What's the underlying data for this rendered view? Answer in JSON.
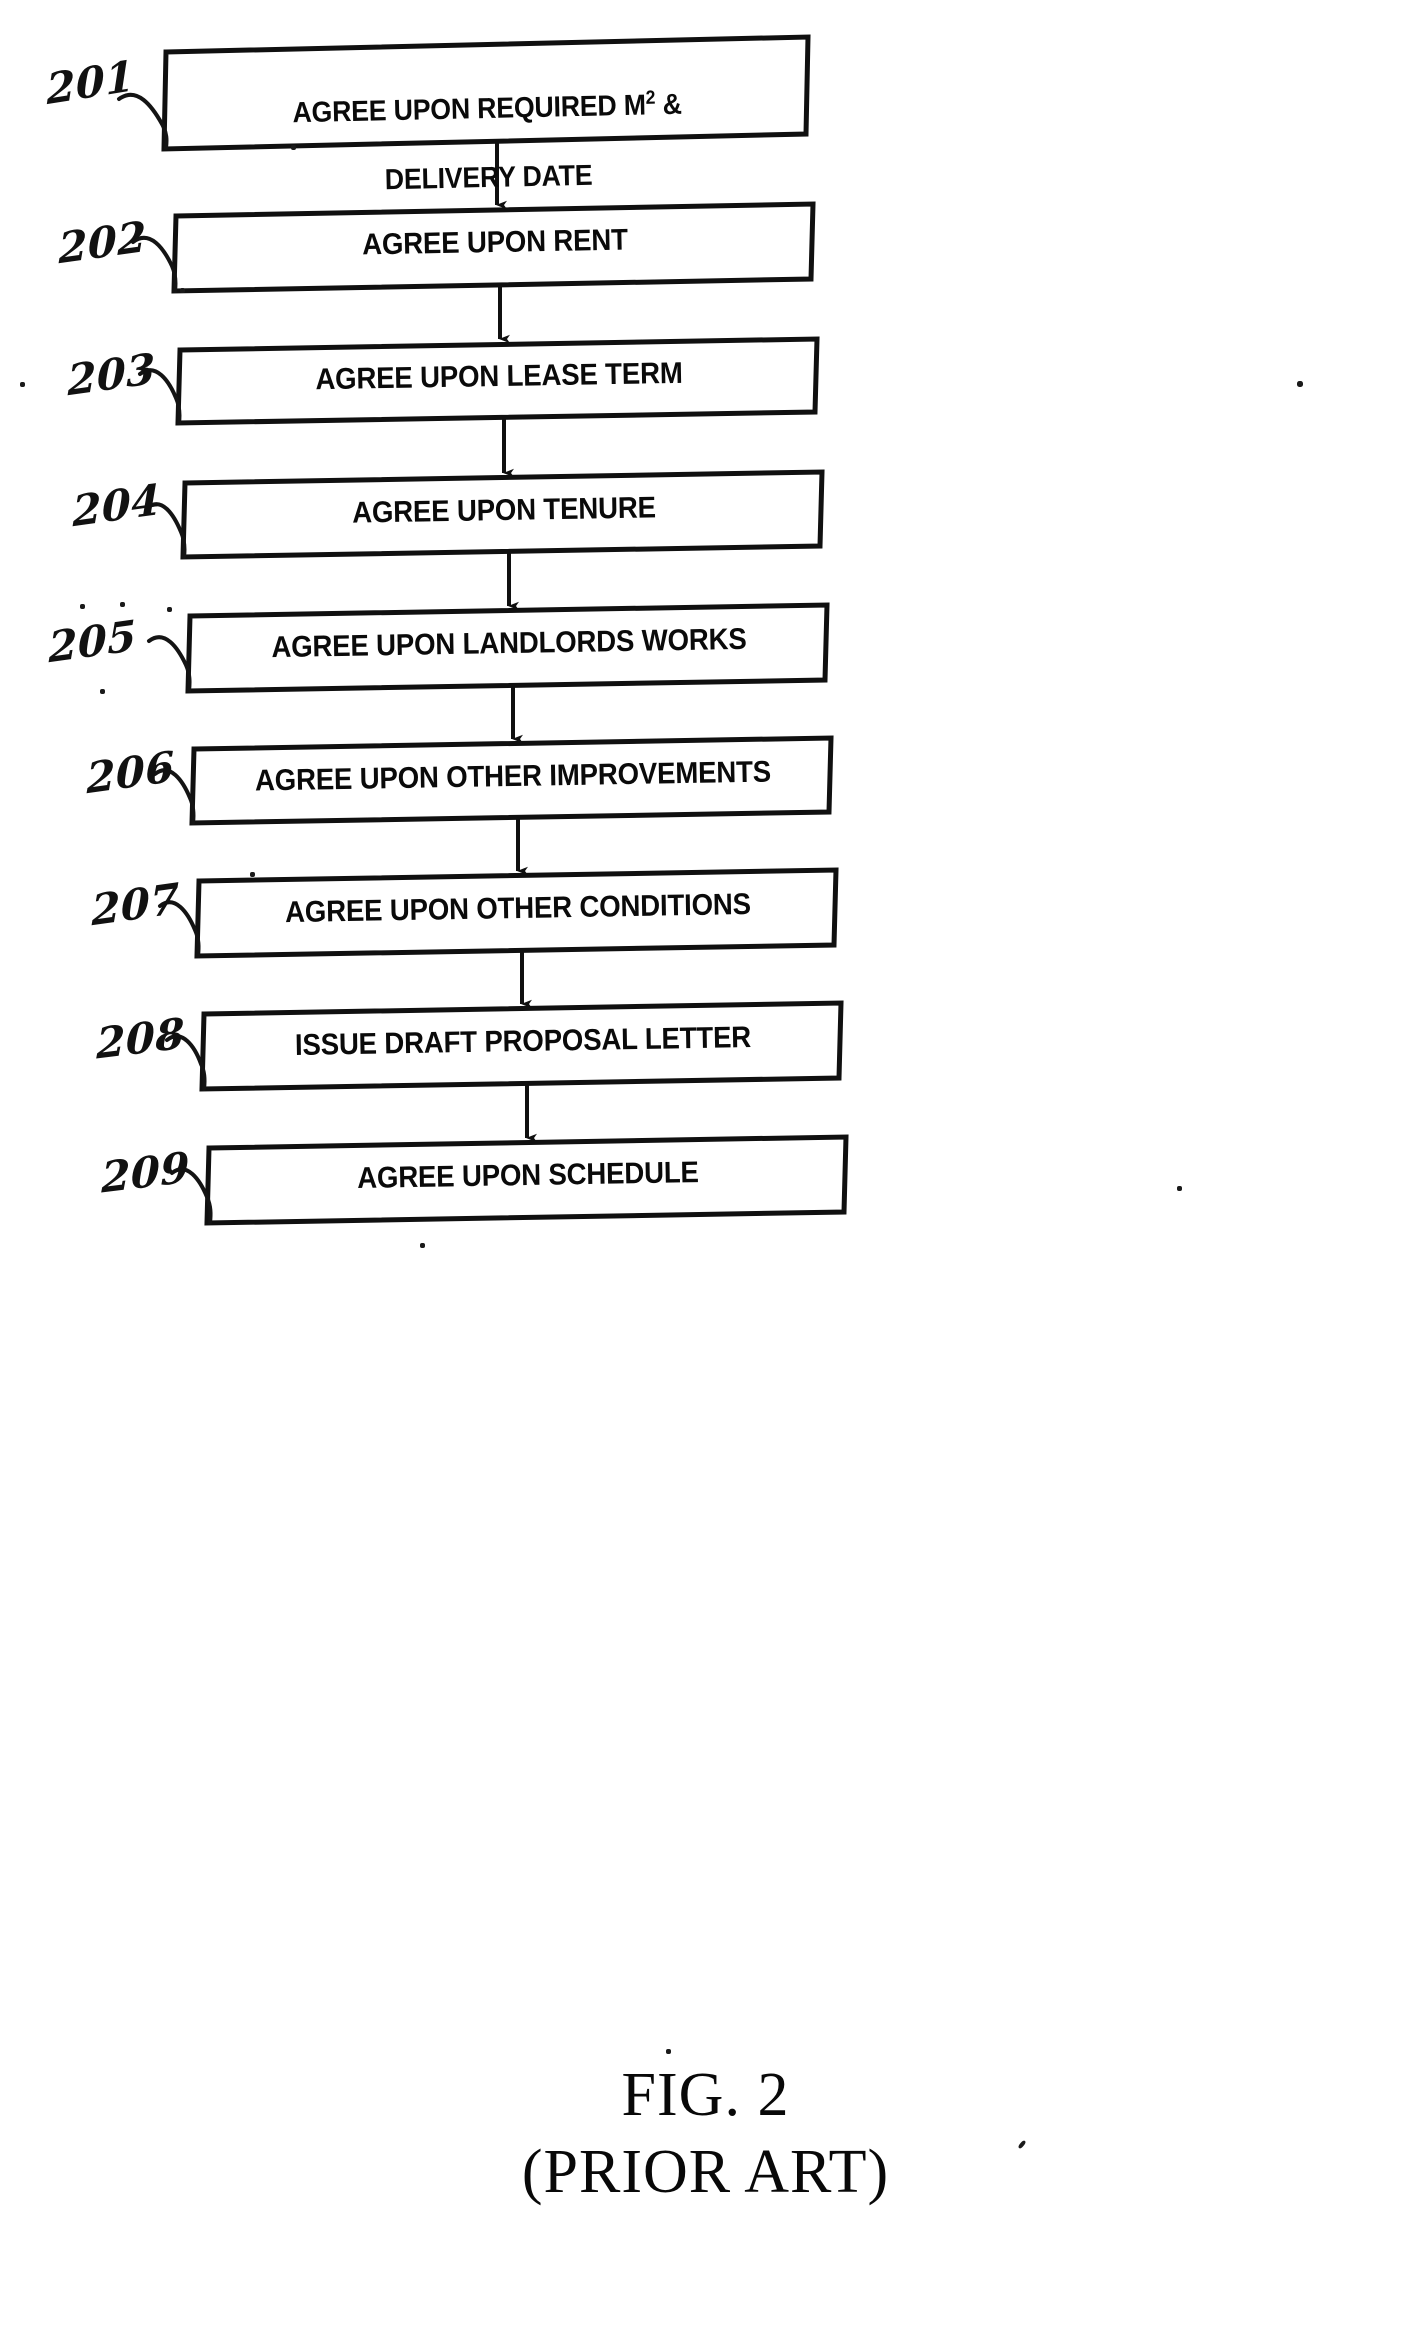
{
  "figure": {
    "caption_line_1": "FIG. 2",
    "caption_line_2": "(PRIOR ART)",
    "title": "FIG. 2 (PRIOR ART)",
    "document_type": "patent-flowchart",
    "ink_color": "#0a0a0a",
    "background_color": "#ffffff"
  },
  "flow": {
    "arrow_count": 8,
    "steps": [
      {
        "ref": "201",
        "label_line_1": "AGREE UPON REQUIRED M",
        "label_superscript": "2",
        "label_line_1_tail": " &",
        "label_line_2": "DELIVERY DATE",
        "label_plain": "AGREE UPON REQUIRED M2 & DELIVERY DATE",
        "lines": 2
      },
      {
        "ref": "202",
        "label_plain": "AGREE UPON RENT",
        "lines": 1
      },
      {
        "ref": "203",
        "label_plain": "AGREE UPON LEASE TERM",
        "lines": 1
      },
      {
        "ref": "204",
        "label_plain": "AGREE UPON TENURE",
        "lines": 1
      },
      {
        "ref": "205",
        "label_plain": "AGREE UPON LANDLORDS WORKS",
        "lines": 1
      },
      {
        "ref": "206",
        "label_plain": "AGREE UPON OTHER IMPROVEMENTS",
        "lines": 1
      },
      {
        "ref": "207",
        "label_plain": "AGREE UPON OTHER CONDITIONS",
        "lines": 1
      },
      {
        "ref": "208",
        "label_plain": "ISSUE DRAFT PROPOSAL LETTER",
        "lines": 1
      },
      {
        "ref": "209",
        "label_plain": "AGREE UPON SCHEDULE",
        "lines": 1
      }
    ]
  }
}
